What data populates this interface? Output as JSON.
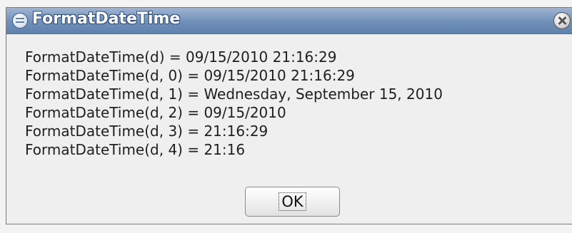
{
  "window": {
    "title": "FormatDateTime",
    "close_icon": "close-icon",
    "app_icon": "app-icon"
  },
  "message": {
    "lines": [
      "FormatDateTime(d) = 09/15/2010 21:16:29",
      "FormatDateTime(d, 0) = 09/15/2010 21:16:29",
      "FormatDateTime(d, 1) = Wednesday, September 15, 2010",
      "FormatDateTime(d, 2) = 09/15/2010",
      "FormatDateTime(d, 3) = 21:16:29",
      "FormatDateTime(d, 4) = 21:16"
    ]
  },
  "buttons": {
    "ok_label": "OK"
  },
  "colors": {
    "titlebar": "#6f8fb8",
    "dialog_background": "#efefef",
    "text": "#1f1f1f"
  }
}
